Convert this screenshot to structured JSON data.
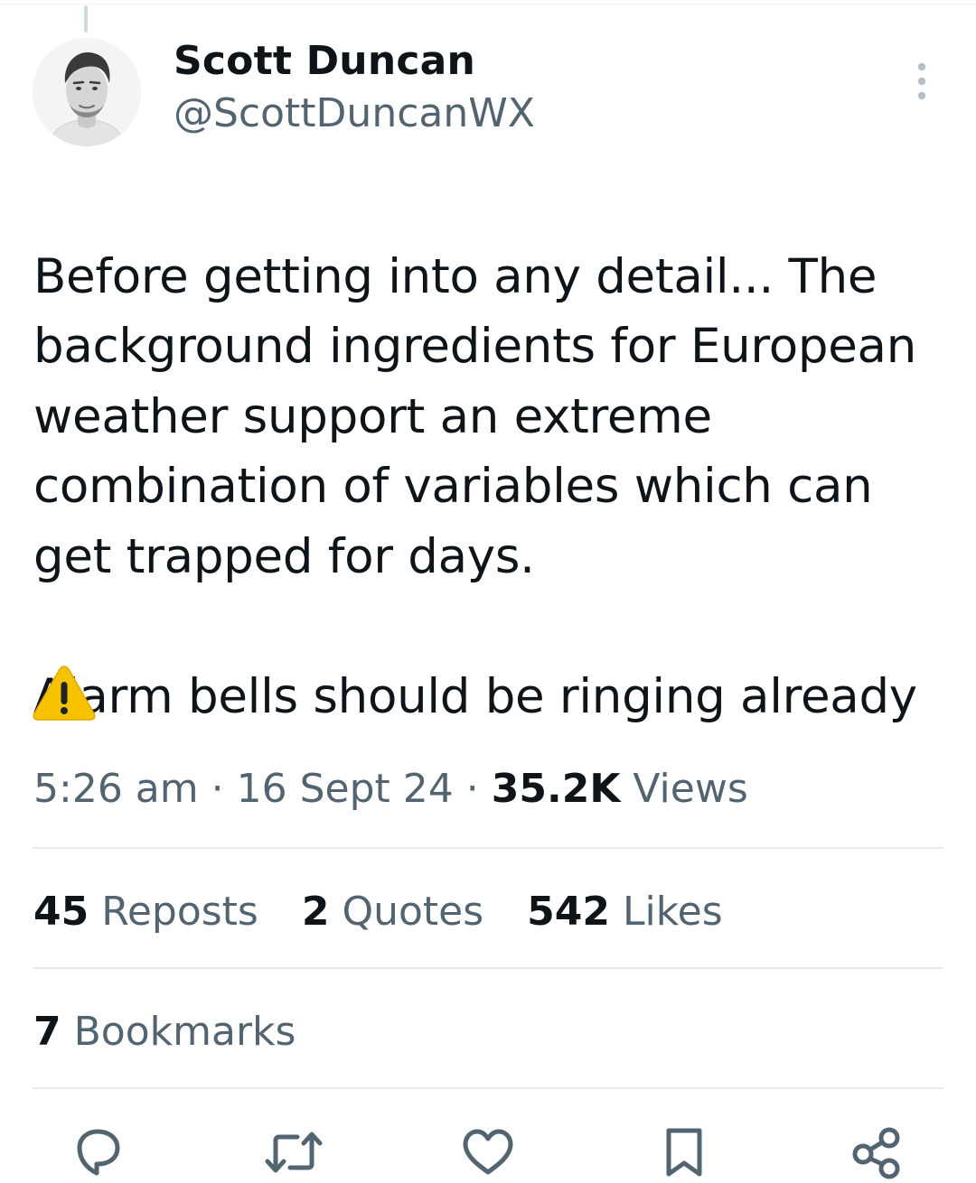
{
  "author": {
    "display_name": "Scott Duncan",
    "handle": "@ScottDuncanWX",
    "avatar_icon": "profile-photo"
  },
  "tweet": {
    "paragraph_1": "Before getting into any detail... The background ingredients for European weather support an extreme combination of variables which can get trapped for days.",
    "paragraph_2": "Alarm bells should be ringing already",
    "emoji": "warning-icon"
  },
  "meta": {
    "time": "5:26 am",
    "separator": "·",
    "date": "16 Sept 24",
    "views_count": "35.2K",
    "views_label": "Views"
  },
  "stats": {
    "reposts_count": "45",
    "reposts_label": "Reposts",
    "quotes_count": "2",
    "quotes_label": "Quotes",
    "likes_count": "542",
    "likes_label": "Likes",
    "bookmarks_count": "7",
    "bookmarks_label": "Bookmarks"
  },
  "actions": [
    "reply-icon",
    "repost-icon",
    "like-icon",
    "bookmark-icon",
    "share-icon"
  ],
  "colors": {
    "primary_text": "#0f1419",
    "secondary_text": "#536471",
    "divider": "#e7eaec",
    "icon": "#536471",
    "warning_yellow": "#f7c300"
  }
}
